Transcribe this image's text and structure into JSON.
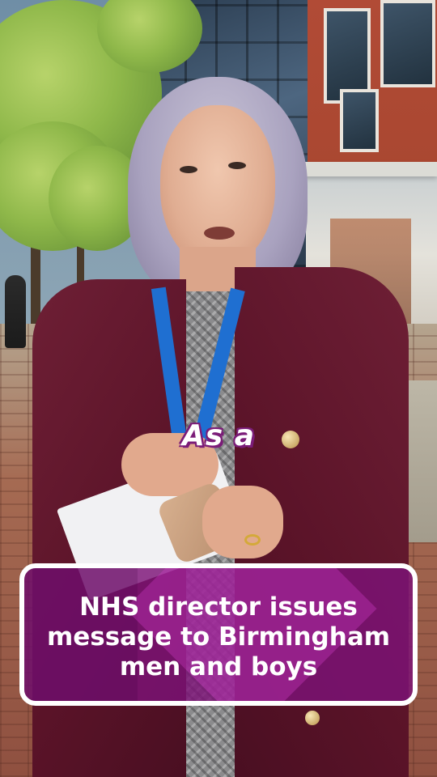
{
  "caption": {
    "current_word": "As a"
  },
  "headline": {
    "lines": [
      "NHS director issues",
      "message to Birmingham",
      "men and boys"
    ]
  },
  "colors": {
    "caption_text": "#ffffff",
    "caption_outline": "#7b1c78",
    "card_background": "#7d1278",
    "card_border": "#ffffff"
  }
}
